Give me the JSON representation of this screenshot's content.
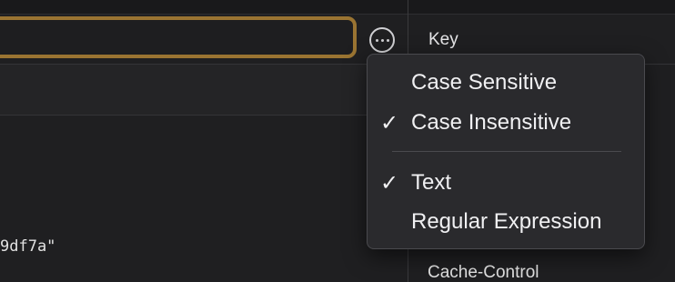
{
  "search": {
    "value": "",
    "placeholder": ""
  },
  "options_button": {
    "icon": "ellipsis-circle-icon"
  },
  "table": {
    "key_header": "Key",
    "rows": [
      {
        "value_fragment": "9df7a\"",
        "key_fragment": "Cache-Control"
      }
    ]
  },
  "menu": {
    "items": [
      {
        "label": "Case Sensitive",
        "checked": false,
        "check_mark": ""
      },
      {
        "label": "Case Insensitive",
        "checked": true,
        "check_mark": "✓"
      },
      {
        "label": "Text",
        "checked": true,
        "check_mark": "✓"
      },
      {
        "label": "Regular Expression",
        "checked": false,
        "check_mark": ""
      }
    ]
  },
  "colors": {
    "focus_ring": "#9a7432",
    "menu_bg": "#2a2a2d",
    "window_bg": "#1f1f21"
  }
}
